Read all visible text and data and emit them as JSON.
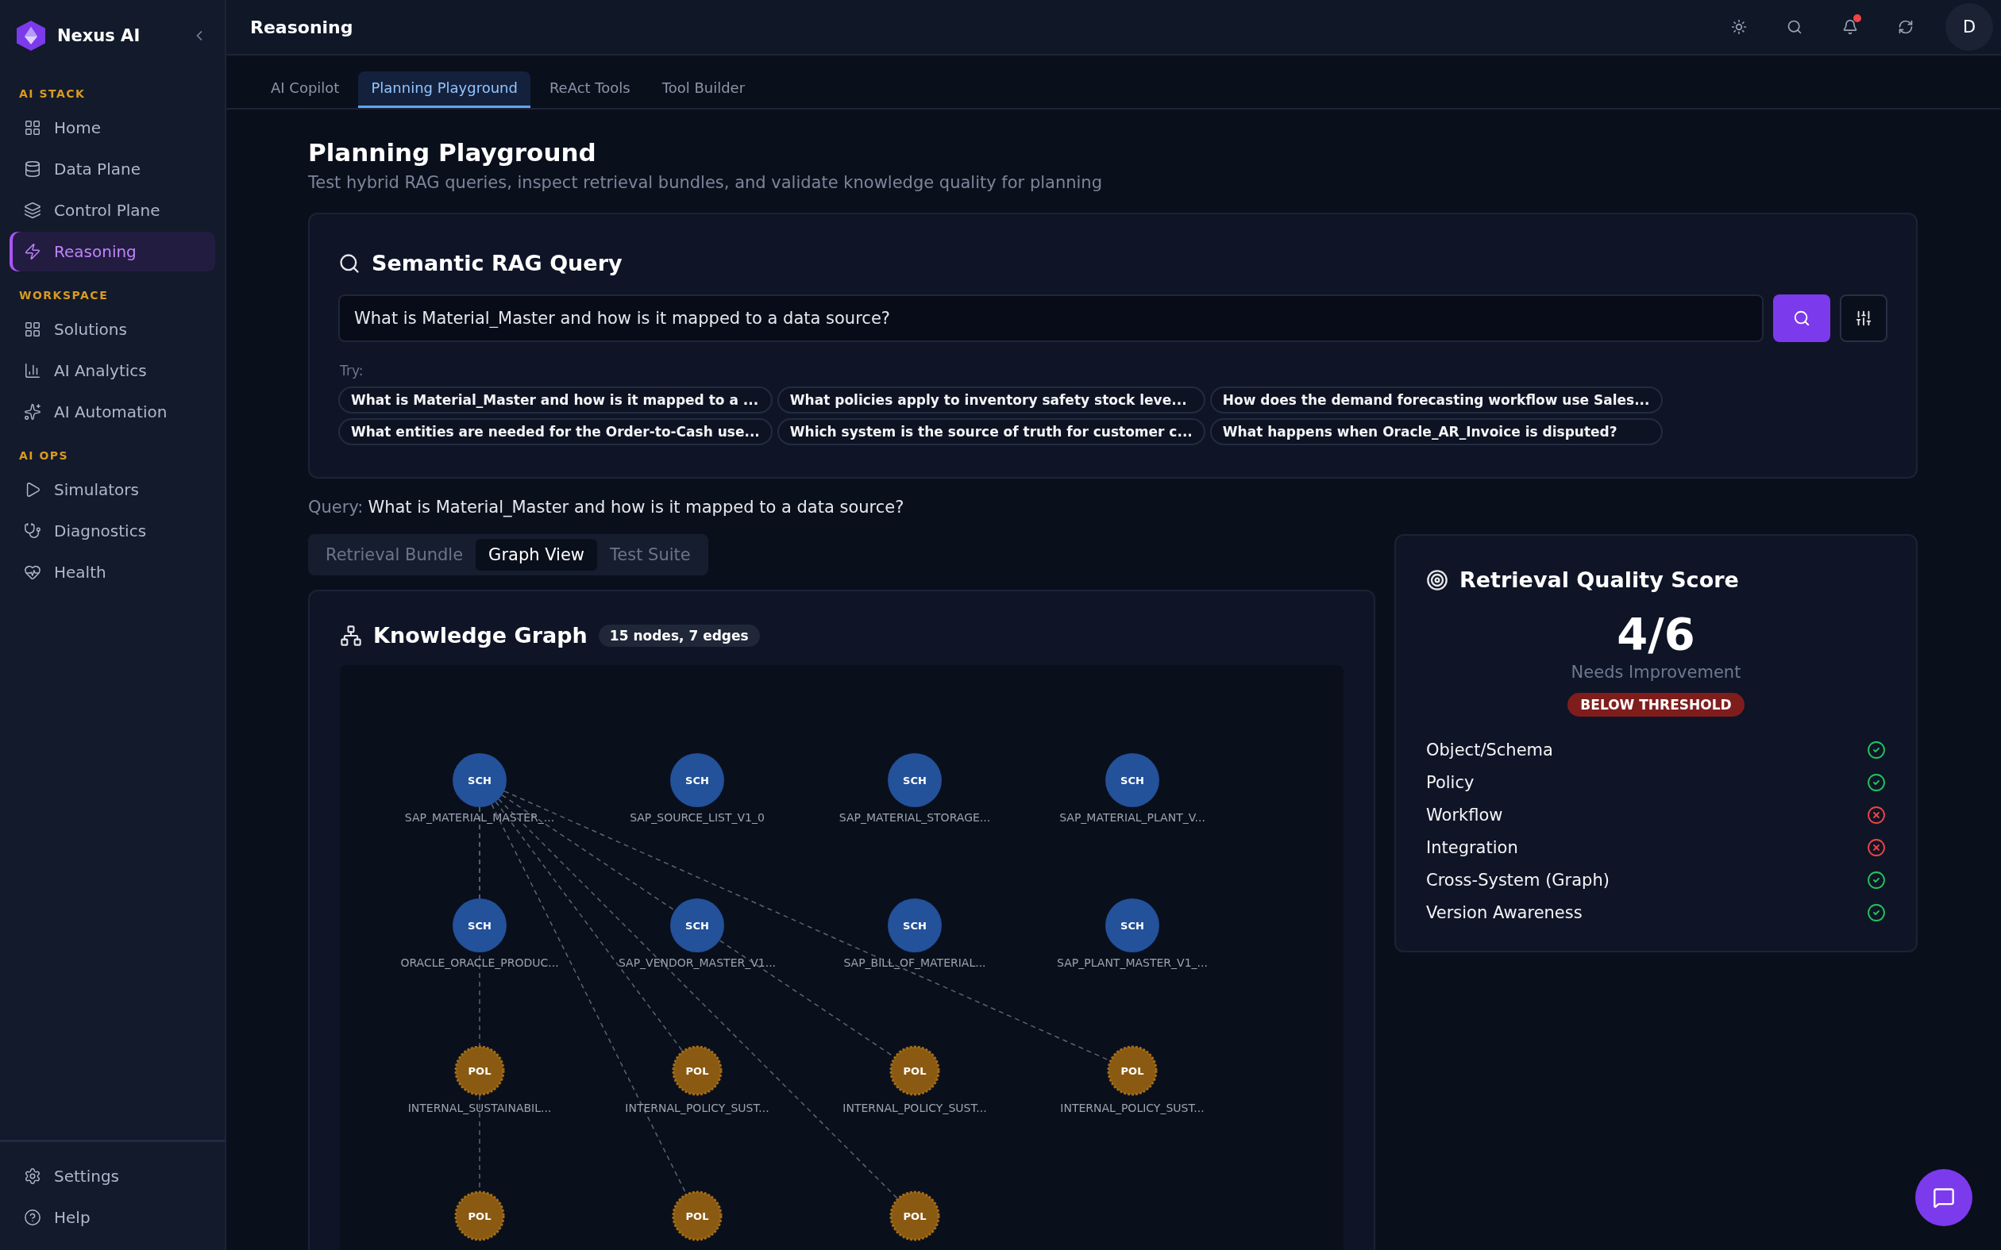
{
  "brand": {
    "name": "Nexus AI"
  },
  "sidebar": {
    "sections": [
      {
        "title": "AI STACK",
        "items": [
          {
            "label": "Home",
            "selected": false
          },
          {
            "label": "Data Plane",
            "selected": false
          },
          {
            "label": "Control Plane",
            "selected": false
          },
          {
            "label": "Reasoning",
            "selected": true
          }
        ]
      },
      {
        "title": "WORKSPACE",
        "items": [
          {
            "label": "Solutions",
            "selected": false
          },
          {
            "label": "AI Analytics",
            "selected": false
          },
          {
            "label": "AI Automation",
            "selected": false
          }
        ]
      },
      {
        "title": "AI OPS",
        "items": [
          {
            "label": "Simulators",
            "selected": false
          },
          {
            "label": "Diagnostics",
            "selected": false
          },
          {
            "label": "Health",
            "selected": false
          }
        ]
      }
    ],
    "footer": [
      {
        "label": "Settings"
      },
      {
        "label": "Help"
      }
    ]
  },
  "header": {
    "title": "Reasoning",
    "has_notification": true,
    "avatar": "D"
  },
  "tabs": [
    {
      "label": "AI Copilot",
      "selected": false
    },
    {
      "label": "Planning Playground",
      "selected": true
    },
    {
      "label": "ReAct Tools",
      "selected": false
    },
    {
      "label": "Tool Builder",
      "selected": false
    }
  ],
  "page": {
    "title": "Planning Playground",
    "subtitle": "Test hybrid RAG queries, inspect retrieval bundles, and validate knowledge quality for planning"
  },
  "query_card": {
    "title": "Semantic RAG Query",
    "value": "What is Material_Master and how is it mapped to a data source?",
    "try_label": "Try:",
    "suggestions": [
      "What is Material_Master and how is it mapped to a ...",
      "What policies apply to inventory safety stock leve...",
      "How does the demand forecasting workflow use Sales...",
      "What entities are needed for the Order-to-Cash use...",
      "Which system is the source of truth for customer c...",
      "What happens when Oracle_AR_Invoice is disputed?"
    ]
  },
  "query_line": {
    "label": "Query:",
    "text": "What is Material_Master and how is it mapped to a data source?"
  },
  "view_tabs": [
    {
      "label": "Retrieval Bundle",
      "selected": false
    },
    {
      "label": "Graph View",
      "selected": true
    },
    {
      "label": "Test Suite",
      "selected": false
    }
  ],
  "graph": {
    "title": "Knowledge Graph",
    "badge": "15 nodes, 7 edges",
    "nodes": [
      {
        "type": "SCH",
        "label": "SAP_MATERIAL_MASTER_..."
      },
      {
        "type": "SCH",
        "label": "SAP_SOURCE_LIST_V1_0"
      },
      {
        "type": "SCH",
        "label": "SAP_MATERIAL_STORAGE..."
      },
      {
        "type": "SCH",
        "label": "SAP_MATERIAL_PLANT_V..."
      },
      {
        "type": "SCH",
        "label": "ORACLE_ORACLE_PRODUC..."
      },
      {
        "type": "SCH",
        "label": "SAP_VENDOR_MASTER_V1..."
      },
      {
        "type": "SCH",
        "label": "SAP_BILL_OF_MATERIAL..."
      },
      {
        "type": "SCH",
        "label": "SAP_PLANT_MASTER_V1_..."
      },
      {
        "type": "POL",
        "label": "INTERNAL_SUSTAINABIL..."
      },
      {
        "type": "POL",
        "label": "INTERNAL_POLICY_SUST..."
      },
      {
        "type": "POL",
        "label": "INTERNAL_POLICY_SUST..."
      },
      {
        "type": "POL",
        "label": "INTERNAL_POLICY_SUST..."
      },
      {
        "type": "POL"
      },
      {
        "type": "POL"
      },
      {
        "type": "POL"
      }
    ]
  },
  "score_card": {
    "title": "Retrieval Quality Score",
    "score": "4/6",
    "verdict": "Needs Improvement",
    "badge": "BELOW THRESHOLD",
    "checks": [
      {
        "label": "Object/Schema",
        "passed": true
      },
      {
        "label": "Policy",
        "passed": true
      },
      {
        "label": "Workflow",
        "passed": false
      },
      {
        "label": "Integration",
        "passed": false
      },
      {
        "label": "Cross-System (Graph)",
        "passed": true
      },
      {
        "label": "Version Awareness",
        "passed": true
      }
    ]
  }
}
